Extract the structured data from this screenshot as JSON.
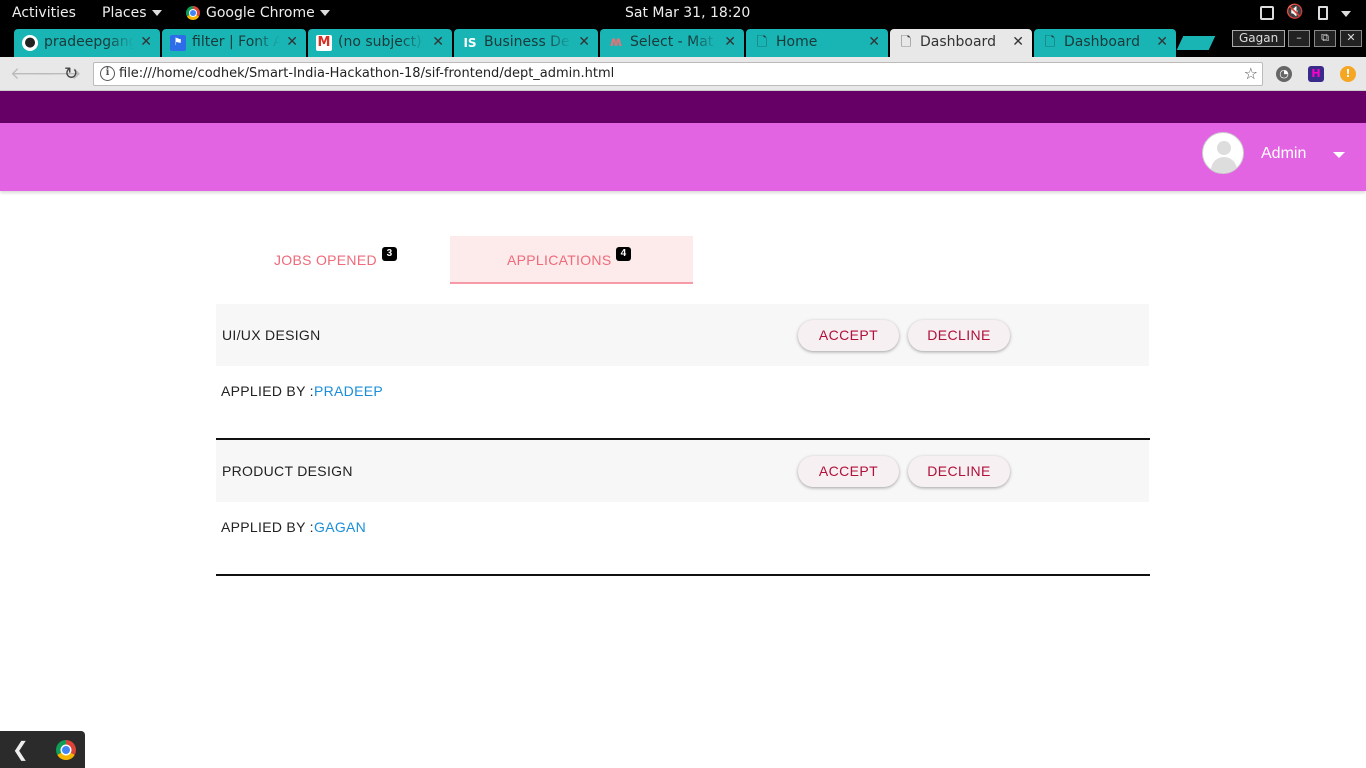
{
  "system_bar": {
    "activities": "Activities",
    "places": "Places",
    "app_menu": "Google Chrome",
    "clock": "Sat Mar 31, 18:20"
  },
  "browser": {
    "tabs": [
      {
        "title": "pradeepgang",
        "icon": "github-icon",
        "active": false
      },
      {
        "title": "filter | Font A",
        "icon": "flag-icon",
        "active": false
      },
      {
        "title": "(no subject) -",
        "icon": "gmail-icon",
        "active": false
      },
      {
        "title": "Business De",
        "icon": "is-logo-icon",
        "active": false
      },
      {
        "title": "Select - Mat",
        "icon": "materialize-icon",
        "active": false
      },
      {
        "title": "Home",
        "icon": "page-icon",
        "active": false
      },
      {
        "title": "Dashboard",
        "icon": "page-icon",
        "active": true
      },
      {
        "title": "Dashboard",
        "icon": "page-icon",
        "active": false
      }
    ],
    "profile": "Gagan",
    "url": "file:///home/codhek/Smart-India-Hackathon-18/sif-frontend/dept_admin.html",
    "accent_color": "#19b5b5"
  },
  "page": {
    "header": {
      "user_name": "Admin",
      "strip_color": "#660066",
      "header_color": "#e364e3"
    },
    "tabs": [
      {
        "label": "JOBS OPENED",
        "count": "3",
        "active": false
      },
      {
        "label": "APPLICATIONS",
        "count": "4",
        "active": true
      }
    ],
    "applications": [
      {
        "job_title": "UI/UX DESIGN",
        "applied_by_label": "APPLIED BY :",
        "applicant": "PRADEEP",
        "accept_label": "ACCEPT",
        "decline_label": "DECLINE"
      },
      {
        "job_title": "PRODUCT DESIGN",
        "applied_by_label": "APPLIED BY :",
        "applicant": "GAGAN",
        "accept_label": "ACCEPT",
        "decline_label": "DECLINE"
      }
    ]
  }
}
